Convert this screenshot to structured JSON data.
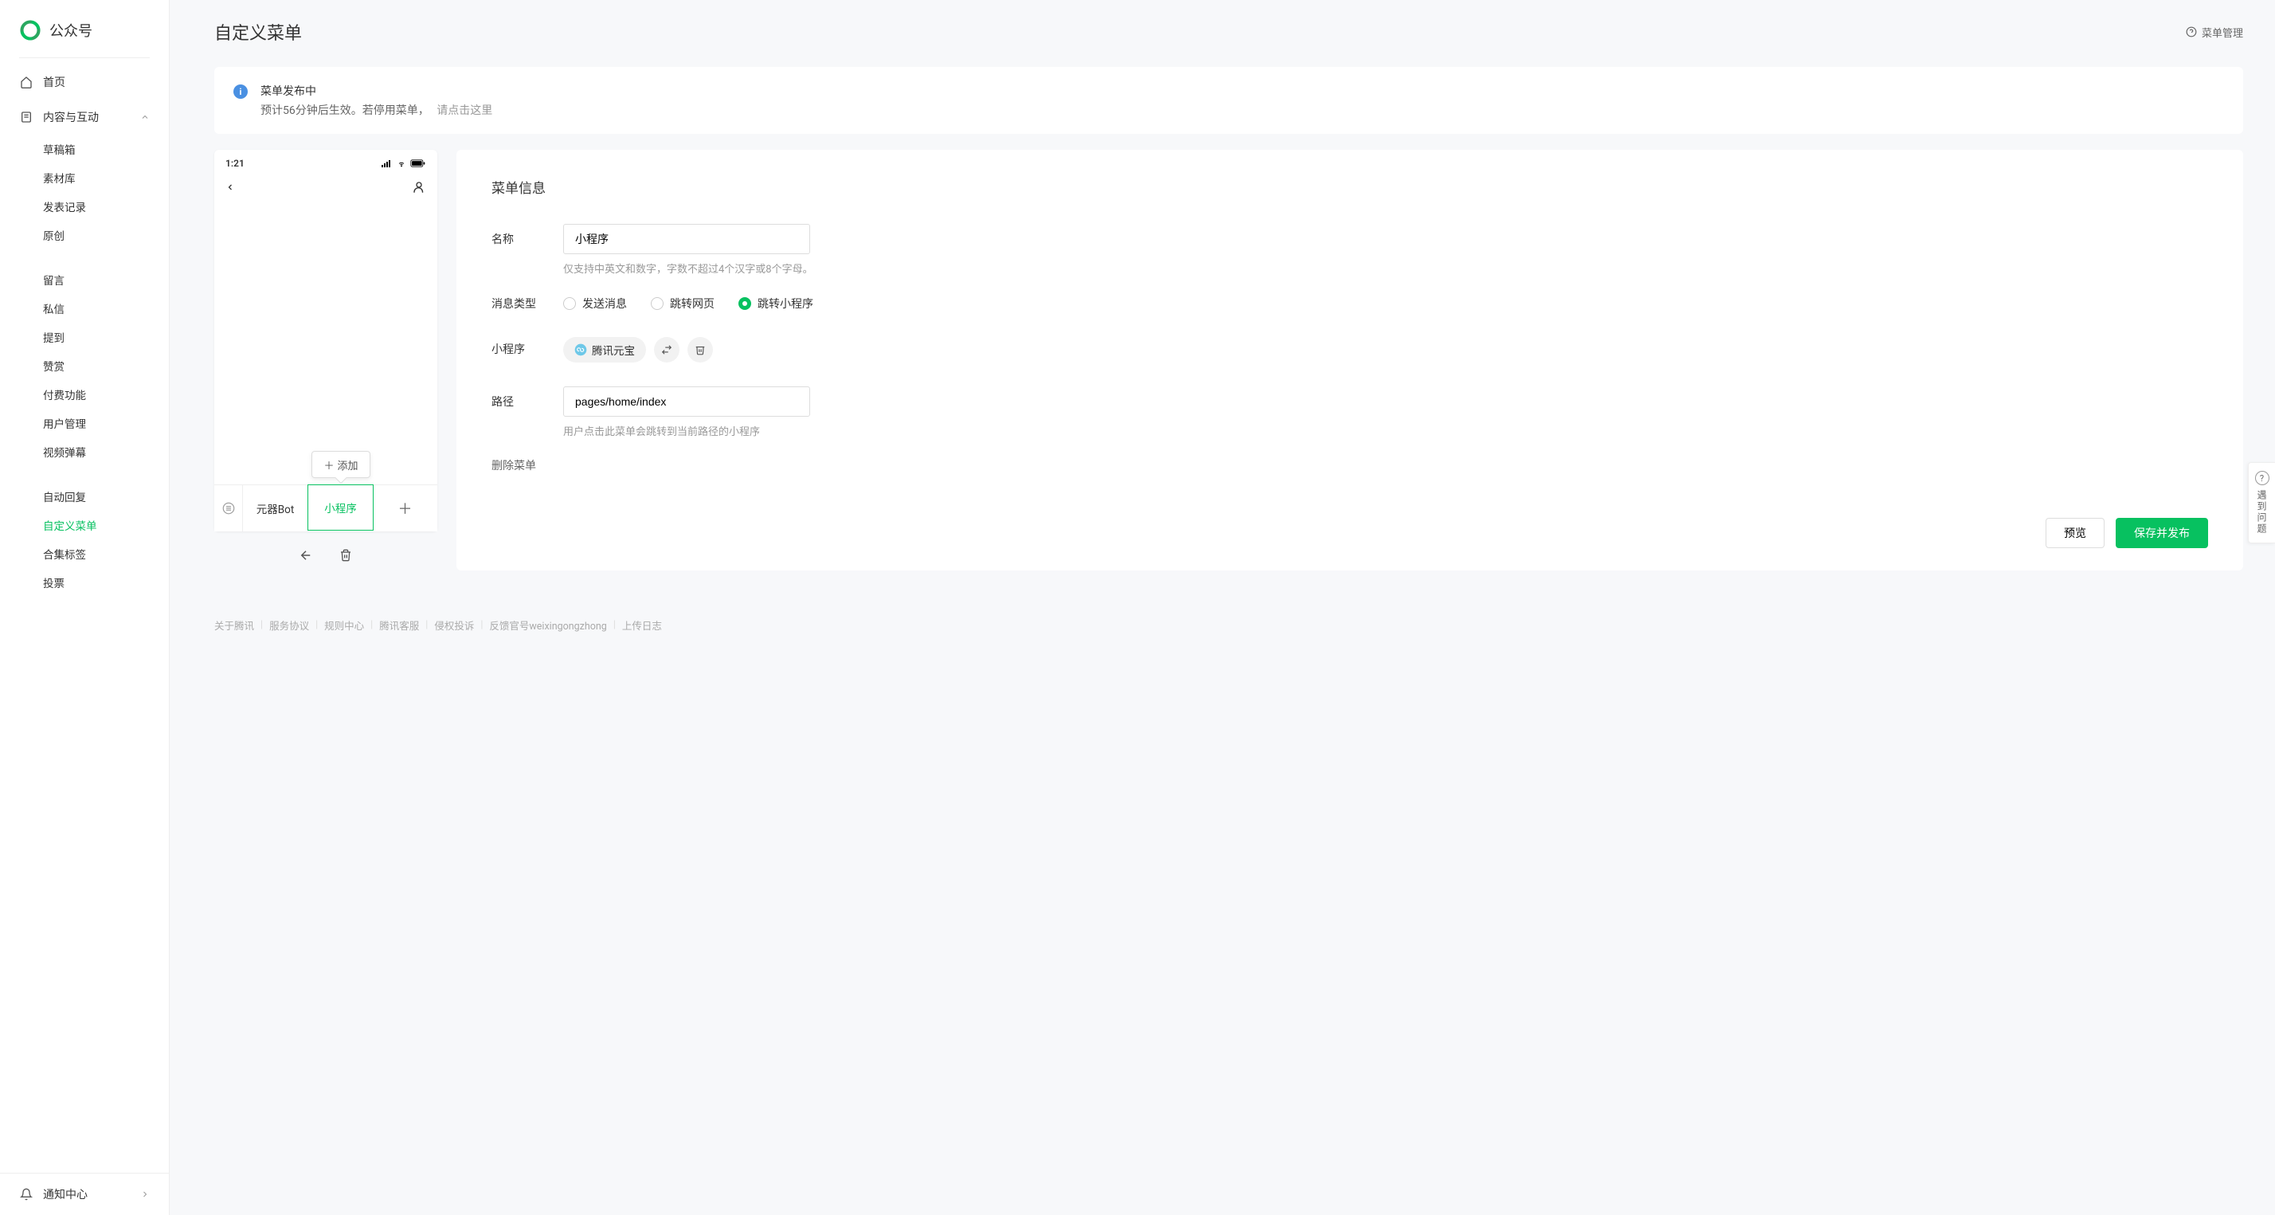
{
  "brand": "公众号",
  "sidebar": {
    "home": "首页",
    "content_group": "内容与互动",
    "items": {
      "drafts": "草稿箱",
      "assets": "素材库",
      "publish_log": "发表记录",
      "original": "原创",
      "comments": "留言",
      "dm": "私信",
      "mention": "提到",
      "reward": "赞赏",
      "paid": "付费功能",
      "user_mgmt": "用户管理",
      "video_danmu": "视频弹幕",
      "auto_reply": "自动回复",
      "custom_menu": "自定义菜单",
      "collection_tag": "合集标签",
      "vote": "投票"
    },
    "notification": "通知中心"
  },
  "page": {
    "title": "自定义菜单",
    "help_link": "菜单管理"
  },
  "alert": {
    "title": "菜单发布中",
    "text": "预计56分钟后生效。若停用菜单，",
    "link": "请点击这里"
  },
  "phone": {
    "time": "1:21",
    "add_submenu": "添加",
    "menus": {
      "m1": "元器Bot",
      "m2": "小程序"
    }
  },
  "detail": {
    "title": "菜单信息",
    "name_label": "名称",
    "name_value": "小程序",
    "name_hint": "仅支持中英文和数字，字数不超过4个汉字或8个字母。",
    "type_label": "消息类型",
    "type_options": {
      "send": "发送消息",
      "url": "跳转网页",
      "miniprogram": "跳转小程序"
    },
    "type_selected": "miniprogram",
    "mp_label": "小程序",
    "mp_name": "腾讯元宝",
    "path_label": "路径",
    "path_value": "pages/home/index",
    "path_hint": "用户点击此菜单会跳转到当前路径的小程序",
    "delete": "删除菜单",
    "preview": "预览",
    "publish": "保存并发布"
  },
  "float_help": "遇到问题",
  "footer": {
    "about": "关于腾讯",
    "tos": "服务协议",
    "rules": "规则中心",
    "support": "腾讯客服",
    "infringe": "侵权投诉",
    "feedback": "反馈官号weixingongzhong",
    "upload_log": "上传日志"
  }
}
